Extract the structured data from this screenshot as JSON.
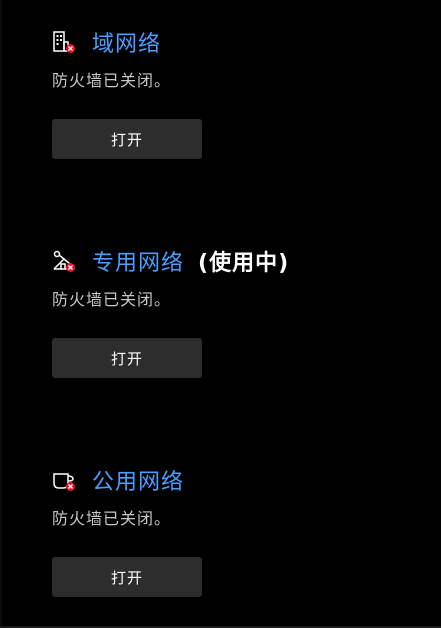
{
  "sections": [
    {
      "title": "域网络",
      "in_use": "",
      "status": "防火墙已关闭。",
      "button_label": "打开",
      "icon": "domain-network-icon"
    },
    {
      "title": "专用网络",
      "in_use": "(使用中)",
      "status": "防火墙已关闭。",
      "button_label": "打开",
      "icon": "private-network-icon"
    },
    {
      "title": "公用网络",
      "in_use": "",
      "status": "防火墙已关闭。",
      "button_label": "打开",
      "icon": "public-network-icon"
    }
  ],
  "colors": {
    "link": "#4a9eff",
    "button_bg": "#2d2d2d",
    "status_text": "#c8c8c8",
    "error_badge": "#e81123"
  }
}
